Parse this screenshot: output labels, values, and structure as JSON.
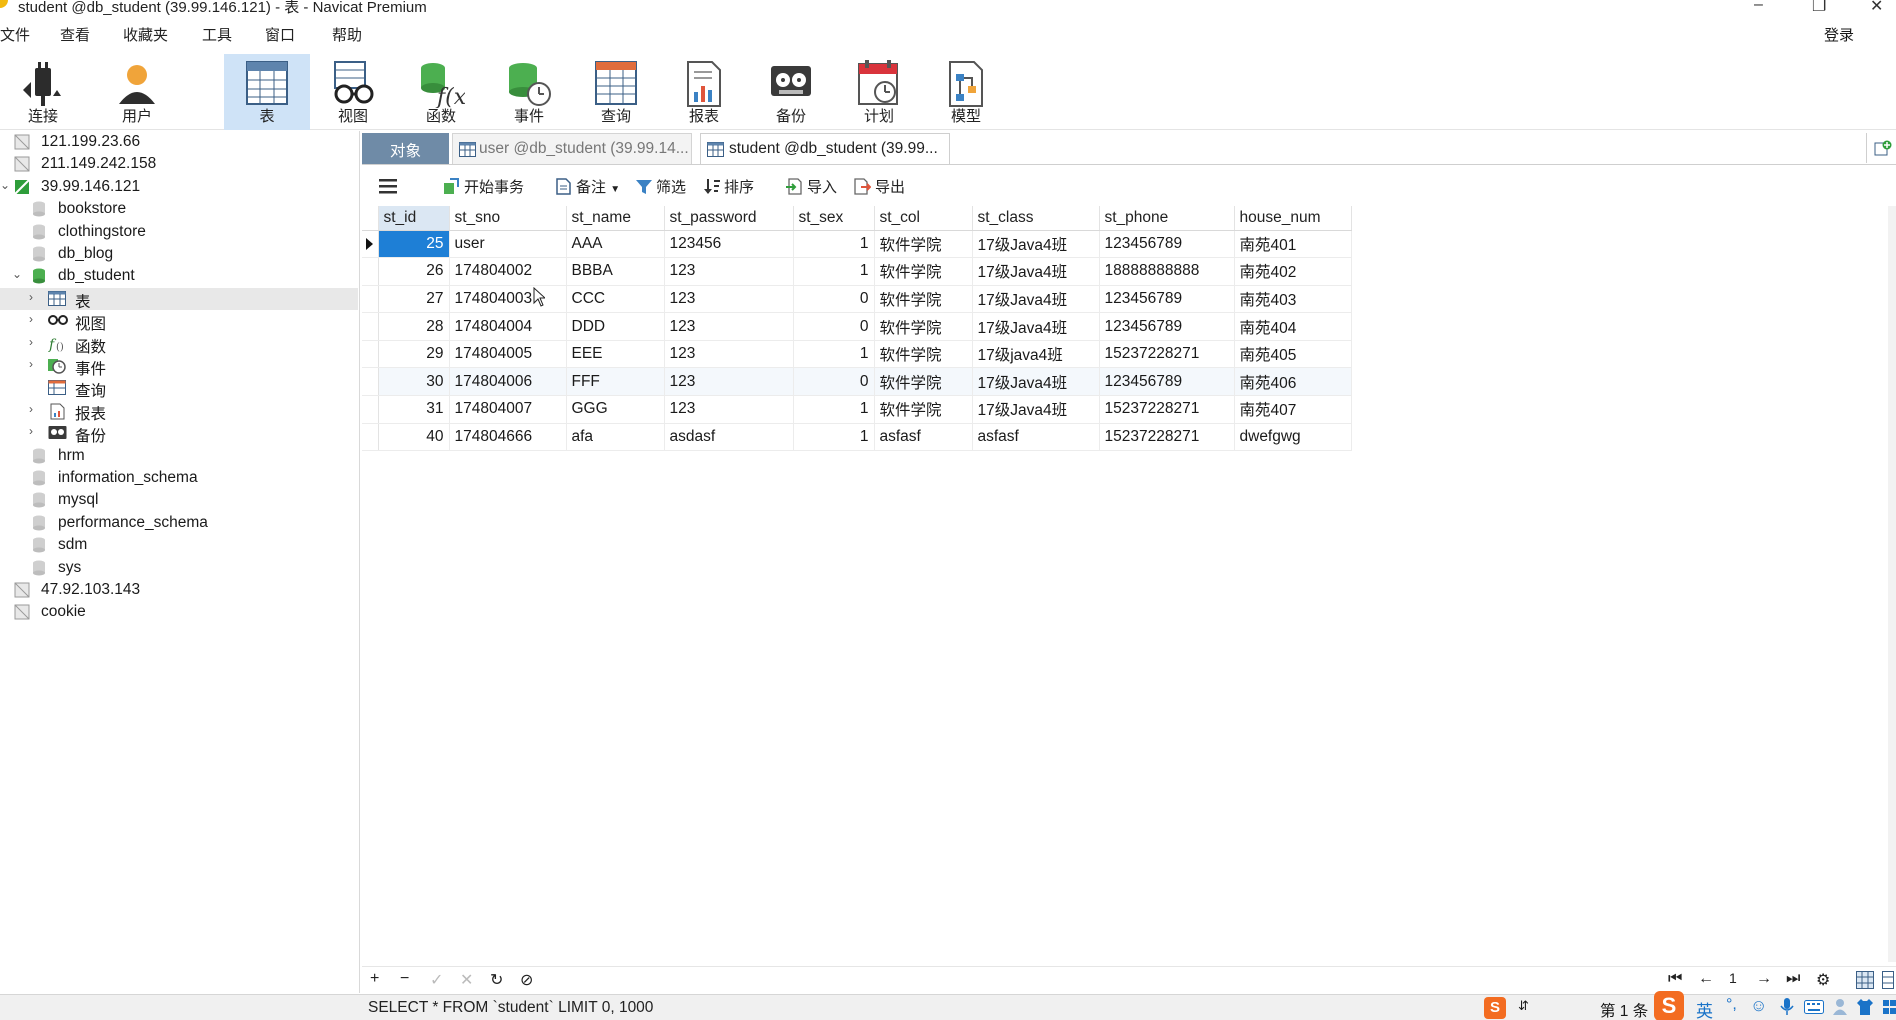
{
  "window": {
    "title": "student @db_student (39.99.146.121) - 表 - Navicat Premium",
    "minimize": "–",
    "restore": "❐",
    "close": "✕"
  },
  "menu": {
    "items": [
      "文件",
      "查看",
      "收藏夹",
      "工具",
      "窗口",
      "帮助"
    ],
    "login": "登录"
  },
  "toolbar": {
    "items": [
      {
        "label": "连接",
        "icon": "connection-plug-icon"
      },
      {
        "label": "用户",
        "icon": "user-icon"
      },
      {
        "label": "表",
        "icon": "table-icon",
        "active": true
      },
      {
        "label": "视图",
        "icon": "view-glasses-icon"
      },
      {
        "label": "函数",
        "icon": "function-icon"
      },
      {
        "label": "事件",
        "icon": "event-icon"
      },
      {
        "label": "查询",
        "icon": "query-icon"
      },
      {
        "label": "报表",
        "icon": "report-icon"
      },
      {
        "label": "备份",
        "icon": "backup-icon"
      },
      {
        "label": "计划",
        "icon": "schedule-icon"
      },
      {
        "label": "模型",
        "icon": "model-icon"
      }
    ]
  },
  "sidebar": {
    "tree": [
      {
        "label": "121.199.23.66",
        "type": "connection"
      },
      {
        "label": "211.149.242.158",
        "type": "connection"
      },
      {
        "label": "39.99.146.121",
        "type": "connection-open"
      },
      {
        "label": "bookstore",
        "type": "database"
      },
      {
        "label": "clothingstore",
        "type": "database"
      },
      {
        "label": "db_blog",
        "type": "database"
      },
      {
        "label": "db_student",
        "type": "database-open"
      },
      {
        "label": "表",
        "type": "tables",
        "selected": true
      },
      {
        "label": "视图",
        "type": "views"
      },
      {
        "label": "函数",
        "type": "functions"
      },
      {
        "label": "事件",
        "type": "events"
      },
      {
        "label": "查询",
        "type": "queries"
      },
      {
        "label": "报表",
        "type": "reports"
      },
      {
        "label": "备份",
        "type": "backups"
      },
      {
        "label": "hrm",
        "type": "database"
      },
      {
        "label": "information_schema",
        "type": "database"
      },
      {
        "label": "mysql",
        "type": "database"
      },
      {
        "label": "performance_schema",
        "type": "database"
      },
      {
        "label": "sdm",
        "type": "database"
      },
      {
        "label": "sys",
        "type": "database"
      },
      {
        "label": "47.92.103.143",
        "type": "connection"
      },
      {
        "label": "cookie",
        "type": "connection"
      }
    ]
  },
  "tabs": {
    "objects": "对象",
    "user_tab": "user @db_student (39.99.14...",
    "student_tab": "student @db_student (39.99..."
  },
  "actions": {
    "begin_transaction": "开始事务",
    "memo": "备注",
    "filter": "筛选",
    "sort": "排序",
    "import": "导入",
    "export": "导出"
  },
  "grid": {
    "columns": [
      "st_id",
      "st_sno",
      "st_name",
      "st_password",
      "st_sex",
      "st_col",
      "st_class",
      "st_phone",
      "house_num"
    ],
    "rows": [
      [
        "25",
        "user",
        "AAA",
        "123456",
        "1",
        "软件学院",
        "17级Java4班",
        "123456789",
        "南苑401"
      ],
      [
        "26",
        "174804002",
        "BBBA",
        "123",
        "1",
        "软件学院",
        "17级Java4班",
        "18888888888",
        "南苑402"
      ],
      [
        "27",
        "174804003",
        "CCC",
        "123",
        "0",
        "软件学院",
        "17级Java4班",
        "123456789",
        "南苑403"
      ],
      [
        "28",
        "174804004",
        "DDD",
        "123",
        "0",
        "软件学院",
        "17级Java4班",
        "123456789",
        "南苑404"
      ],
      [
        "29",
        "174804005",
        "EEE",
        "123",
        "1",
        "软件学院",
        "17级java4班",
        "15237228271",
        "南苑405"
      ],
      [
        "30",
        "174804006",
        "FFF",
        "123",
        "0",
        "软件学院",
        "17级Java4班",
        "123456789",
        "南苑406"
      ],
      [
        "31",
        "174804007",
        "GGG",
        "123",
        "1",
        "软件学院",
        "17级Java4班",
        "15237228271",
        "南苑407"
      ],
      [
        "40",
        "174804666",
        "afa",
        "asdasf",
        "1",
        "asfasf",
        "asfasf",
        "15237228271",
        "dwefgwg"
      ]
    ]
  },
  "footer": {
    "add": "+",
    "remove": "−",
    "apply": "✓",
    "discard": "✕",
    "refresh": "↻",
    "stop": "⊘",
    "page_number": "1",
    "first": "⏮",
    "prev": "←",
    "next": "→",
    "last": "⏭",
    "settings": "⚙"
  },
  "status": {
    "sql": "SELECT * FROM `student` LIMIT 0, 1000",
    "record": "第 1 条"
  },
  "ime": {
    "mode": "英"
  }
}
